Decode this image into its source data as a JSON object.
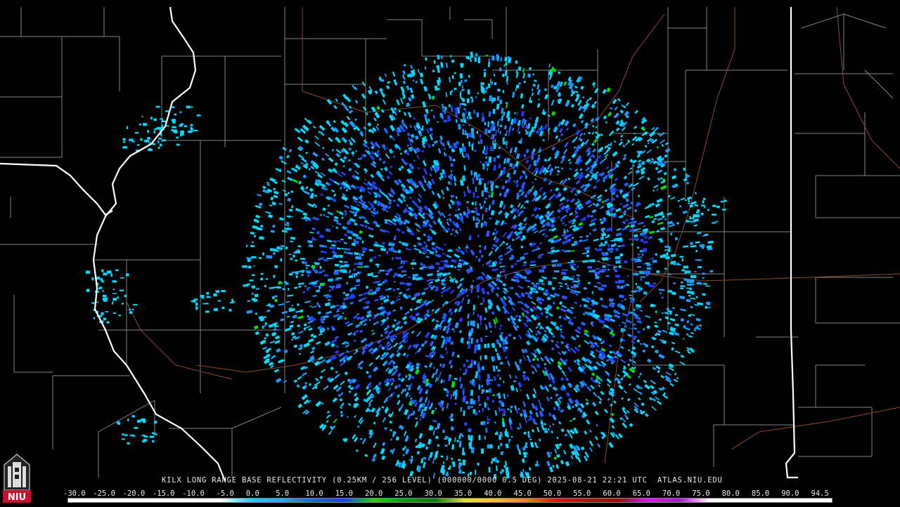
{
  "caption": "KILX LONG RANGE BASE REFLECTIVITY (0.25KM / 256 LEVEL) (000000/0000 0.5 DEG) 2025-08-21 22:21 UTC  ATLAS.NIU.EDU",
  "scale": {
    "labels": [
      "-30.0",
      "-25.0",
      "-20.0",
      "-15.0",
      "-10.0",
      "-5.0",
      "0.0",
      "5.0",
      "10.0",
      "15.0",
      "20.0",
      "25.0",
      "30.0",
      "35.0",
      "40.0",
      "45.0",
      "50.0",
      "55.0",
      "60.0",
      "65.0",
      "70.0",
      "75.0",
      "80.0",
      "85.0",
      "90.0",
      "94.5"
    ],
    "colors": [
      "#ffffff",
      "#ffffff",
      "#ffffff",
      "#ffffff",
      "#ffffff",
      "#ffffff",
      "#00d8ff",
      "#00b0ff",
      "#1a66ff",
      "#1e3cff",
      "#00e000",
      "#00a000",
      "#008000",
      "#e8e800",
      "#ffc000",
      "#ff8000",
      "#ff0000",
      "#c80000",
      "#a00000",
      "#ff00ff",
      "#c000ff",
      "#ffffff",
      "#ffffff",
      "#ffffff",
      "#ffffff",
      "#ffffff"
    ]
  },
  "logo": {
    "text": "NIU",
    "color": "#c8102e"
  },
  "map": {
    "radar_site": "KILX",
    "layers": [
      "county-borders",
      "state-borders",
      "highways",
      "reflectivity"
    ]
  }
}
